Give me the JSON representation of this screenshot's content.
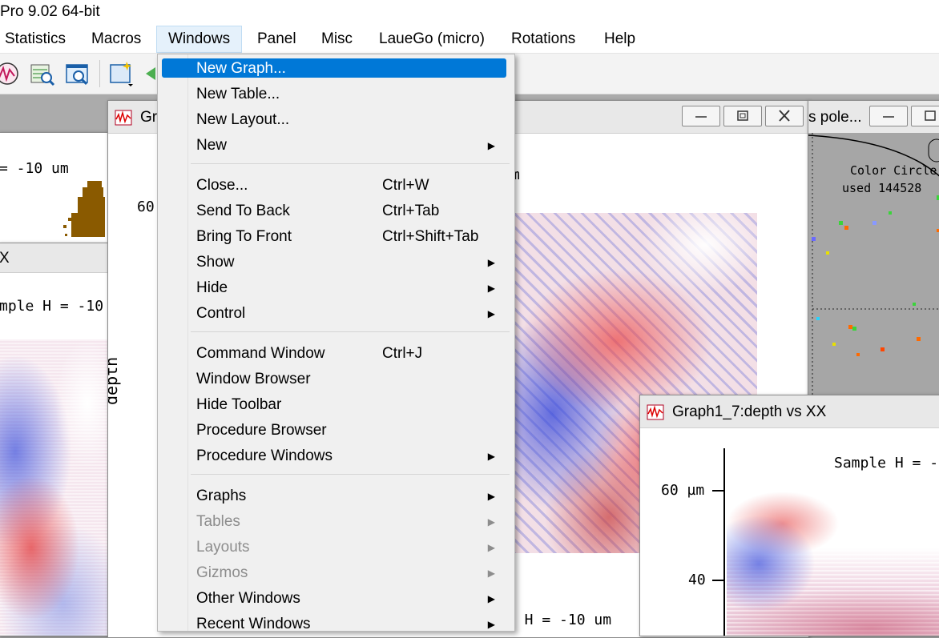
{
  "app": {
    "title": "Pro 9.02 64-bit"
  },
  "menubar": [
    {
      "label": "Statistics"
    },
    {
      "label": "Macros"
    },
    {
      "label": "Windows"
    },
    {
      "label": "Panel"
    },
    {
      "label": "Misc"
    },
    {
      "label": "LaueGo (micro)"
    },
    {
      "label": "Rotations"
    },
    {
      "label": "Help"
    }
  ],
  "windows_menu": {
    "items": [
      {
        "label": "New Graph...",
        "shortcut": "",
        "submenu": false
      },
      {
        "label": "New Table...",
        "shortcut": "",
        "submenu": false
      },
      {
        "label": "New Layout...",
        "shortcut": "",
        "submenu": false
      },
      {
        "label": "New",
        "shortcut": "",
        "submenu": true
      },
      {
        "label": "Close...",
        "shortcut": "Ctrl+W",
        "submenu": false
      },
      {
        "label": "Send To Back",
        "shortcut": "Ctrl+Tab",
        "submenu": false
      },
      {
        "label": "Bring To Front",
        "shortcut": "Ctrl+Shift+Tab",
        "submenu": false
      },
      {
        "label": "Show",
        "shortcut": "",
        "submenu": true
      },
      {
        "label": "Hide",
        "shortcut": "",
        "submenu": true
      },
      {
        "label": "Control",
        "shortcut": "",
        "submenu": true
      },
      {
        "label": "Command Window",
        "shortcut": "Ctrl+J",
        "submenu": false
      },
      {
        "label": "Window Browser",
        "shortcut": "",
        "submenu": false
      },
      {
        "label": "Hide Toolbar",
        "shortcut": "",
        "submenu": false
      },
      {
        "label": "Procedure Browser",
        "shortcut": "",
        "submenu": false
      },
      {
        "label": "Procedure Windows",
        "shortcut": "",
        "submenu": true
      },
      {
        "label": "Graphs",
        "shortcut": "",
        "submenu": true
      },
      {
        "label": "Tables",
        "shortcut": "",
        "submenu": true,
        "disabled": true
      },
      {
        "label": "Layouts",
        "shortcut": "",
        "submenu": true,
        "disabled": true
      },
      {
        "label": "Gizmos",
        "shortcut": "",
        "submenu": true,
        "disabled": true
      },
      {
        "label": "Other Windows",
        "shortcut": "",
        "submenu": true
      },
      {
        "label": "Recent Windows",
        "shortcut": "",
        "submenu": true
      }
    ],
    "arrow_glyph": "▶"
  },
  "graphs": {
    "left_top": {
      "annotation": "= -10 um"
    },
    "left_mid": {
      "title_fragment": "X",
      "annotation": "mple H = -10"
    },
    "center": {
      "title_fragment": "Gr",
      "ylabel": "depth",
      "tick_fragment": "60",
      "annotation_fragment": "m",
      "bottom_annotation": "e H = -10 um"
    },
    "right_top": {
      "title_fragment": "s pole...",
      "line1": "Color Circle",
      "line2": "used 144528"
    },
    "front": {
      "title": "Graph1_7:depth vs XX",
      "annotation": "Sample H = -",
      "tick_60": "60 µm",
      "tick_40": "40"
    }
  },
  "colors": {
    "selection": "#0078d7",
    "menu_bg": "#f0f0f0",
    "disabled_text": "#8d8d8d"
  }
}
